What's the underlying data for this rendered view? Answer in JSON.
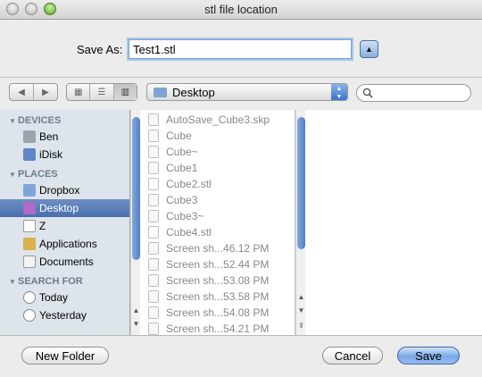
{
  "window": {
    "title": "stl file location"
  },
  "saveas": {
    "label": "Save As:",
    "value": "Test1.stl"
  },
  "toolbar": {
    "back_icon": "back-arrow-icon",
    "forward_icon": "forward-arrow-icon",
    "view_modes": [
      "icon-view-icon",
      "list-view-icon",
      "column-view-icon"
    ],
    "location": "Desktop",
    "search_placeholder": ""
  },
  "sidebar": {
    "sections": [
      {
        "title": "DEVICES",
        "items": [
          {
            "label": "Ben",
            "icon": "hard-drive-icon"
          },
          {
            "label": "iDisk",
            "icon": "idisk-icon"
          }
        ]
      },
      {
        "title": "PLACES",
        "items": [
          {
            "label": "Dropbox",
            "icon": "dropbox-icon"
          },
          {
            "label": "Desktop",
            "icon": "desktop-icon",
            "selected": true
          },
          {
            "label": "Z",
            "icon": "home-icon"
          },
          {
            "label": "Applications",
            "icon": "applications-icon"
          },
          {
            "label": "Documents",
            "icon": "documents-icon"
          }
        ]
      },
      {
        "title": "SEARCH FOR",
        "items": [
          {
            "label": "Today",
            "icon": "clock-icon"
          },
          {
            "label": "Yesterday",
            "icon": "clock-icon"
          }
        ]
      }
    ]
  },
  "files": [
    "AutoSave_Cube3.skp",
    "Cube",
    "Cube~",
    "Cube1",
    "Cube2.stl",
    "Cube3",
    "Cube3~",
    "Cube4.stl",
    "Screen sh...46.12 PM",
    "Screen sh...52.44 PM",
    "Screen sh...53.08 PM",
    "Screen sh...53.58 PM",
    "Screen sh...54.08 PM",
    "Screen sh...54.21 PM"
  ],
  "buttons": {
    "new_folder": "New Folder",
    "cancel": "Cancel",
    "save": "Save"
  }
}
